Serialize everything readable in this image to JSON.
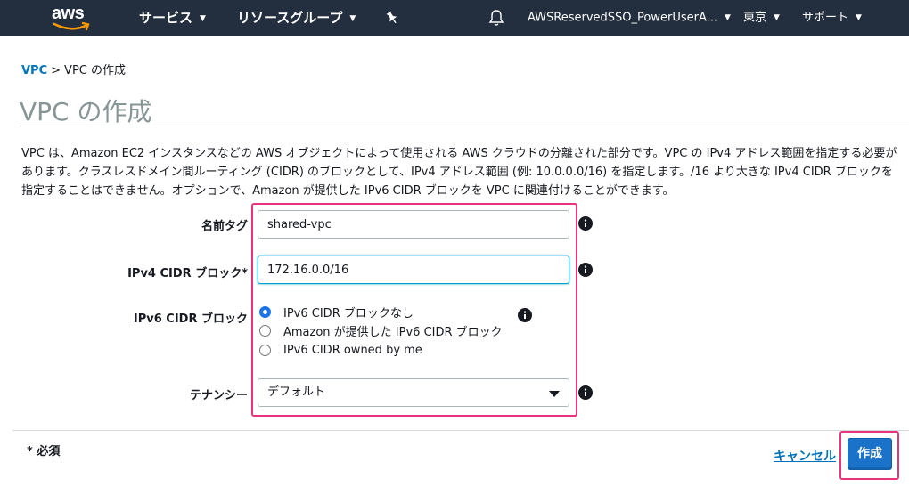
{
  "nav": {
    "logo": "aws",
    "services": "サービス",
    "resource_groups": "リソースグループ",
    "account": "AWSReservedSSO_PowerUserA...",
    "region": "東京",
    "support": "サポート",
    "icons": [
      "pin-icon",
      "bell-icon",
      "chevron-down-icon"
    ],
    "background": "#232f3e"
  },
  "breadcrumb": {
    "parent": "VPC",
    "separator": ">",
    "current": "VPC の作成"
  },
  "page": {
    "title": "VPC の作成",
    "description": "VPC は、Amazon EC2 インスタンスなどの AWS オブジェクトによって使用される AWS クラウドの分離された部分です。VPC の IPv4 アドレス範囲を指定する必要があります。クラスレスドメイン間ルーティング (CIDR) のブロックとして、IPv4 アドレス範囲 (例: 10.0.0.0/16) を指定します。/16 より大きな IPv4 CIDR ブロックを指定することはできません。オプションで、Amazon が提供した IPv6 CIDR ブロックを VPC に関連付けることができます。"
  },
  "form": {
    "name_tag": {
      "label": "名前タグ",
      "value": "shared-vpc"
    },
    "ipv4_cidr": {
      "label": "IPv4 CIDR ブロック*",
      "value": "172.16.0.0/16"
    },
    "ipv6_cidr": {
      "label": "IPv6 CIDR ブロック",
      "options": [
        "IPv6 CIDR ブロックなし",
        "Amazon が提供した IPv6 CIDR ブロック",
        "IPv6 CIDR owned by me"
      ],
      "selected": "IPv6 CIDR ブロックなし"
    },
    "tenancy": {
      "label": "テナンシー",
      "value": "デフォルト"
    }
  },
  "footer": {
    "required_note": "* 必須",
    "cancel": "キャンセル",
    "create": "作成"
  },
  "colors": {
    "accent": "#0073bb",
    "primary_button": "#1a73c9",
    "highlight": "#e8347f"
  }
}
